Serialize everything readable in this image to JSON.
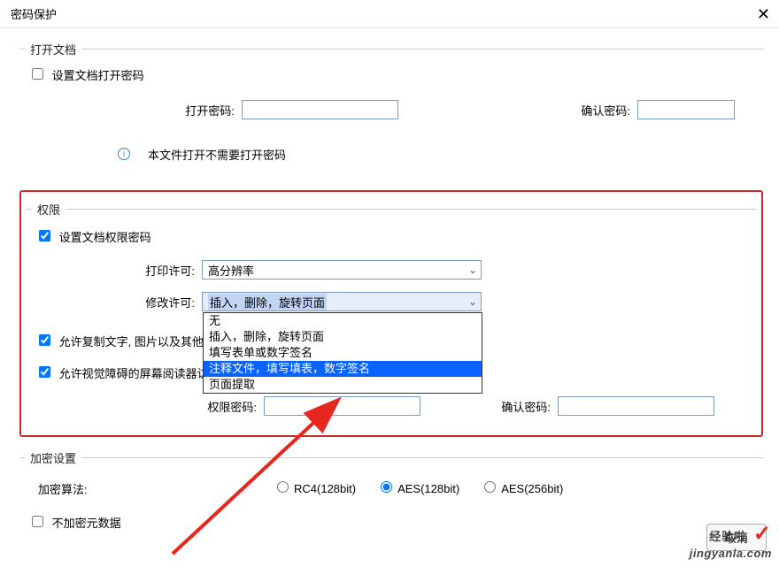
{
  "title": "密码保护",
  "open_doc": {
    "legend": "打开文档",
    "set_open_pw_checkbox": "设置文档打开密码",
    "open_pw_label": "打开密码:",
    "confirm_pw_label": "确认密码:",
    "info_text": "本文件打开不需要打开密码"
  },
  "permission": {
    "legend": "权限",
    "set_perm_pw_checkbox": "设置文档权限密码",
    "print_label": "打印许可:",
    "print_value": "高分辨率",
    "modify_label": "修改许可:",
    "modify_value": "插入，删除，旋转页面",
    "modify_options": [
      "无",
      "插入，删除，旋转页面",
      "填写表单或数字签名",
      "注释文件，填写填表，数字签名",
      "页面提取"
    ],
    "allow_copy_checkbox": "允许复制文字, 图片以及其他",
    "allow_reader_checkbox": "允许视觉障碍的屏幕阅读器访",
    "perm_pw_label": "权限密码:",
    "perm_confirm_label": "确认密码:"
  },
  "encryption": {
    "legend": "加密设置",
    "algo_label": "加密算法:",
    "options": {
      "rc4": "RC4(128bit)",
      "aes128": "AES(128bit)",
      "aes256": "AES(256bit)"
    },
    "no_meta_checkbox": "不加密元数据"
  },
  "buttons": {
    "cancel": "取消"
  },
  "watermark": {
    "top": "经验啦",
    "bottom": "jingyanla.com"
  }
}
